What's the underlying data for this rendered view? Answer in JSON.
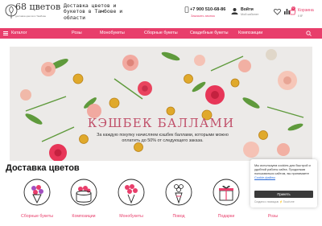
{
  "header": {
    "logo_text": "68 цветов",
    "logo_subtitle": "доставка цветов в Тамбове",
    "tagline": "Доставка цветов и букетов в Тамбове и области",
    "phone": "+7 900 510-68-86",
    "phone_link": "Заказать звонок",
    "login_title": "Войти",
    "login_subtitle": "Мой кабинет",
    "cart_count": "0",
    "cart_title": "Корзина",
    "cart_sum": "0 ₽"
  },
  "nav": {
    "items": [
      {
        "label": "Каталог"
      },
      {
        "label": "Розы"
      },
      {
        "label": "Монобукеты"
      },
      {
        "label": "Сборные букеты"
      },
      {
        "label": "Свадебные букеты"
      },
      {
        "label": "Композиции"
      }
    ]
  },
  "banner": {
    "title": "КЭШБЕК БАЛЛАМИ",
    "text": "За каждую покупку начисляем кэшбек баллами, которыми можно оплатить до 50% от следующего заказа."
  },
  "section": {
    "title": "Доставка цветов",
    "categories": [
      {
        "label": "Сборные букеты",
        "icon": "bouquet-icon"
      },
      {
        "label": "Композиции",
        "icon": "flower-box-icon"
      },
      {
        "label": "Монобукеты",
        "icon": "roses-icon"
      },
      {
        "label": "Повод",
        "icon": "occasion-bouquet-icon"
      },
      {
        "label": "Подарки",
        "icon": "gift-icon"
      },
      {
        "label": "Розы",
        "icon": "rose-icon"
      }
    ]
  },
  "cookie": {
    "text": "Мы используем cookies для быстрой и удобной работы сайта. Продолжая пользоваться сайтом, вы принимаете ",
    "link": "Cookie-файлы",
    "button": "Принять",
    "footer": "Создано с помощью ⚡ Touch.me"
  },
  "colors": {
    "accent": "#e83e6b",
    "banner_bg": "#eceae8",
    "button_dark": "#3a3a3a"
  }
}
